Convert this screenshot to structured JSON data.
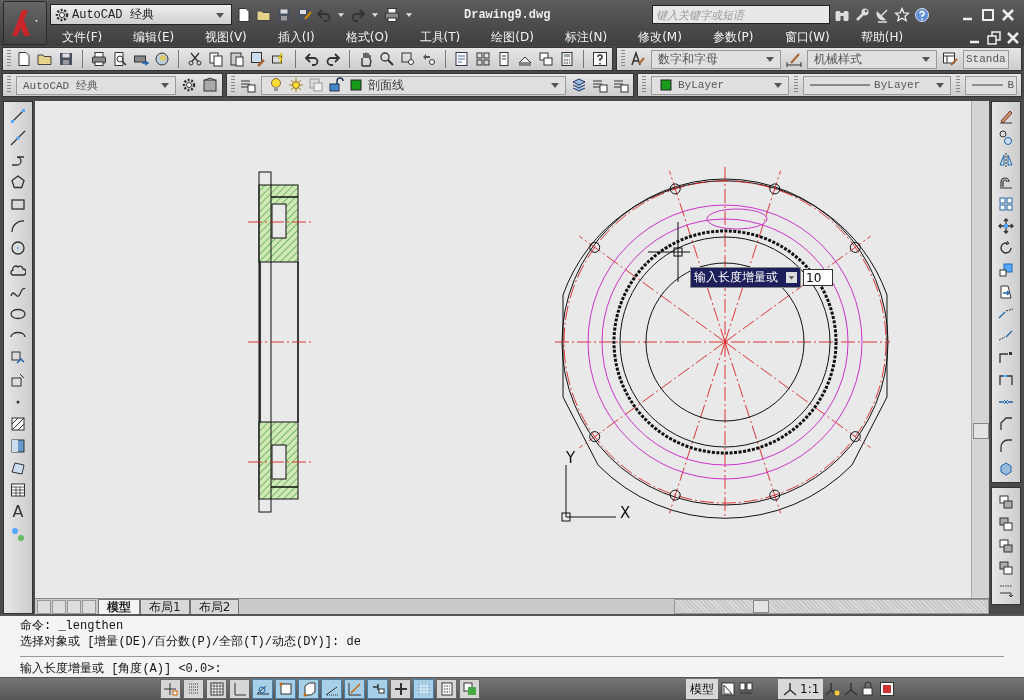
{
  "title_bar": {
    "workspace": "AutoCAD 经典",
    "title": "Drawing9.dwg",
    "search": {
      "placeholder": "键入关键字或短语"
    }
  },
  "menu_bar": {
    "items": [
      "文件(F)",
      "编辑(E)",
      "视图(V)",
      "插入(I)",
      "格式(O)",
      "工具(T)",
      "绘图(D)",
      "标注(N)",
      "修改(M)",
      "参数(P)",
      "窗口(W)",
      "帮助(H)"
    ]
  },
  "toolbars": {
    "text_style": "数字和字母",
    "dim_style": "机械样式",
    "table_style": "Standa",
    "workspace": "AutoCAD 经典",
    "layer": "剖面线",
    "color_control": "ByLayer",
    "linetype": "ByLayer",
    "lineweight": "B"
  },
  "draw_toolbar": {
    "text_tool": "A"
  },
  "canvas": {
    "dynamic_prompt": "输入长度增量或",
    "dynamic_input": "10",
    "ucs_y": "Y",
    "ucs_x": "X"
  },
  "layout_tabs": [
    {
      "label": "模型",
      "selected": true
    },
    {
      "label": "布局1",
      "selected": false
    },
    {
      "label": "布局2",
      "selected": false
    }
  ],
  "command_line": {
    "history": [
      "命令:  _lengthen",
      "选择对象或 [增量(DE)/百分数(P)/全部(T)/动态(DY)]: de"
    ],
    "prompt": "输入长度增量或 [角度(A)] <0.0>:"
  },
  "status_bar": {
    "toggles": [
      {
        "on": false
      },
      {
        "on": false
      },
      {
        "on": false
      },
      {
        "on": false
      },
      {
        "on": true
      },
      {
        "on": true
      },
      {
        "on": true
      },
      {
        "on": true
      },
      {
        "on": true
      },
      {
        "on": true
      },
      {
        "on": false
      },
      {
        "on": true
      },
      {
        "on": false
      },
      {
        "on": false
      }
    ],
    "model_label": "模型",
    "annotation_scale": "1:1"
  }
}
